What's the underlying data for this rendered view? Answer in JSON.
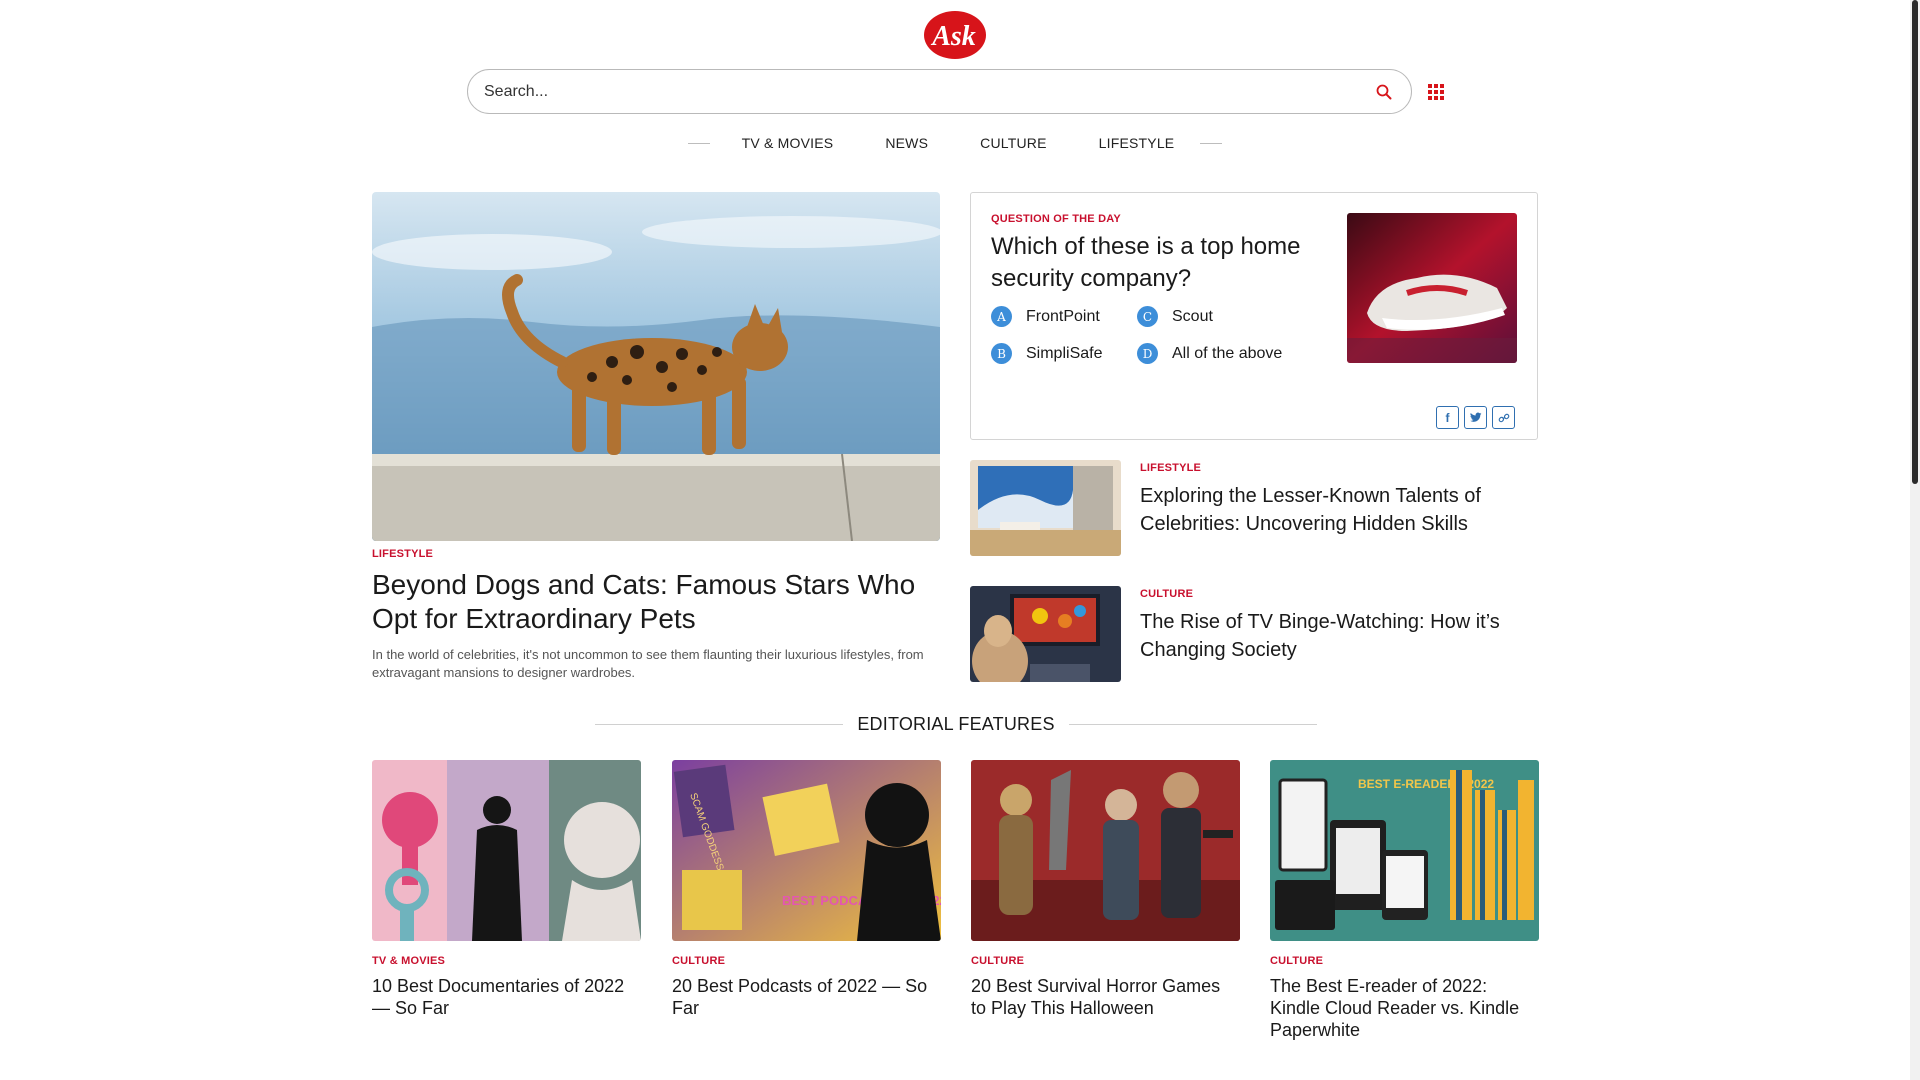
{
  "header": {
    "logo_text": "Ask",
    "search_placeholder": "Search..."
  },
  "nav": {
    "items": [
      {
        "label": "TV & MOVIES"
      },
      {
        "label": "NEWS"
      },
      {
        "label": "CULTURE"
      },
      {
        "label": "LIFESTYLE"
      }
    ]
  },
  "hero": {
    "category": "LIFESTYLE",
    "title": "Beyond Dogs and Cats: Famous Stars Who Opt for Extraordinary Pets",
    "description": "In the world of celebrities, it's not uncommon to see them flaunting their luxurious lifestyles, from extravagant mansions to designer wardrobes."
  },
  "question": {
    "label": "QUESTION OF THE DAY",
    "title": "Which of these is a top home security company?",
    "options": [
      {
        "letter": "A",
        "text": "FrontPoint"
      },
      {
        "letter": "C",
        "text": "Scout"
      },
      {
        "letter": "B",
        "text": "SimpliSafe"
      },
      {
        "letter": "D",
        "text": "All of the above"
      }
    ],
    "share_icons": [
      "facebook-icon",
      "twitter-icon",
      "link-icon"
    ]
  },
  "side_articles": [
    {
      "category": "LIFESTYLE",
      "title": "Exploring the Lesser-Known Talents of Celebrities: Uncovering Hidden Skills"
    },
    {
      "category": "CULTURE",
      "title": "The Rise of TV Binge-Watching: How it’s Changing Society"
    }
  ],
  "editorial": {
    "heading": "EDITORIAL FEATURES",
    "cards": [
      {
        "category": "TV & MOVIES",
        "title": "10 Best Documentaries of 2022 — So Far"
      },
      {
        "category": "CULTURE",
        "title": "20 Best Podcasts of 2022 — So Far",
        "image_text_1": "SCAM GODDESS",
        "image_text_2": "BEST PODCASTS OF 2022"
      },
      {
        "category": "CULTURE",
        "title": "20 Best Survival Horror Games to Play This Halloween"
      },
      {
        "category": "CULTURE",
        "title": "The Best E-reader of 2022: Kindle Cloud Reader vs. Kindle Paperwhite",
        "image_text_1": "BEST E-READERS 2022"
      }
    ]
  },
  "colors": {
    "accent_red": "#c8102e",
    "badge_blue": "#3d8ed9"
  }
}
